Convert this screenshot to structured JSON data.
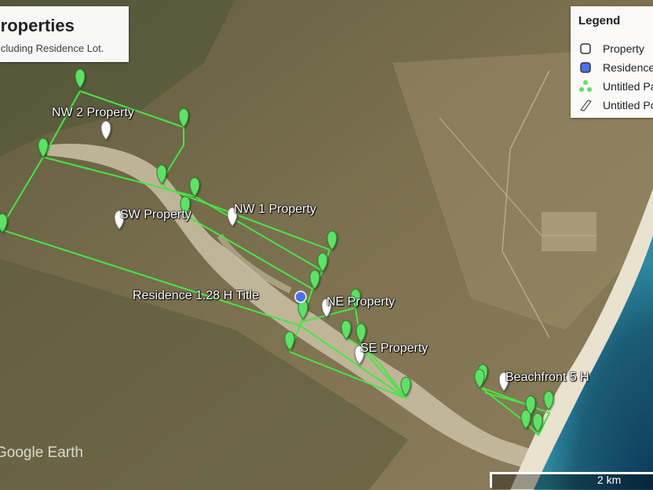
{
  "title": "Properties",
  "subtitle": "Including Residence Lot.",
  "legend": {
    "title": "Legend",
    "items": [
      {
        "label": "Property",
        "icon": "white-square-icon"
      },
      {
        "label": "Residence",
        "icon": "blue-square-icon"
      },
      {
        "label": "Untitled Path",
        "icon": "green-marker-cluster-icon"
      },
      {
        "label": "Untitled Polygon",
        "icon": "polygon-icon"
      }
    ]
  },
  "labels": {
    "nw2": "NW 2 Property",
    "sw": "SW Property",
    "nw1": "NW 1 Property",
    "residence": "Residence 1.28 H Title",
    "ne": "NE Property",
    "se": "SE Property",
    "beach": "Beachfront 5 H"
  },
  "watermark": "Google Earth",
  "scale": "2 km",
  "colors": {
    "path": "#45e645",
    "pin_green": "#5fe066",
    "pin_white": "#ffffff",
    "residence": "#4a72e8"
  }
}
